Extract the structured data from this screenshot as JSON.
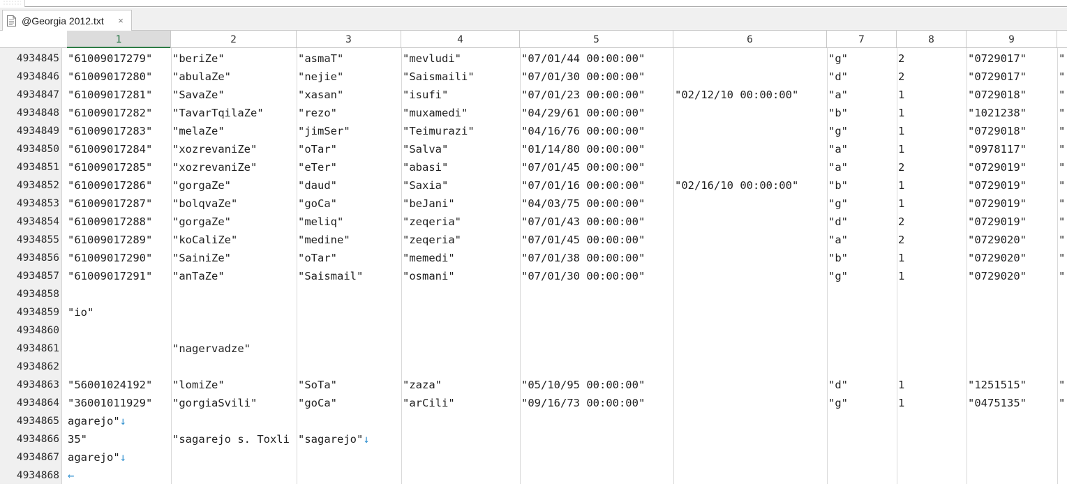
{
  "tab": {
    "title": "@Georgia 2012.txt",
    "close_glyph": "×",
    "icon": "document-icon"
  },
  "columns": [
    "1",
    "2",
    "3",
    "4",
    "5",
    "6",
    "7",
    "8",
    "9"
  ],
  "active_column": 0,
  "colors": {
    "active_column_text": "#1a6f3c",
    "newline_marker": "#2f8fcf"
  },
  "rows": [
    {
      "num": "4934845",
      "cells": [
        "\"61009017279\"",
        "\"beriZe\"",
        "\"asmaT\"",
        "\"mevludi\"",
        "\"07/01/44 00:00:00\"",
        "",
        "\"g\"",
        "2",
        "\"0729017\"",
        "\""
      ]
    },
    {
      "num": "4934846",
      "cells": [
        "\"61009017280\"",
        "\"abulaZe\"",
        "\"nejie\"",
        "\"Saismaili\"",
        "\"07/01/30 00:00:00\"",
        "",
        "\"d\"",
        "2",
        "\"0729017\"",
        "\""
      ]
    },
    {
      "num": "4934847",
      "cells": [
        "\"61009017281\"",
        "\"SavaZe\"",
        "\"xasan\"",
        "\"isufi\"",
        "\"07/01/23 00:00:00\"",
        "\"02/12/10 00:00:00\"",
        "\"a\"",
        "1",
        "\"0729018\"",
        "\""
      ]
    },
    {
      "num": "4934848",
      "cells": [
        "\"61009017282\"",
        "\"TavarTqilaZe\"",
        "\"rezo\"",
        "\"muxamedi\"",
        "\"04/29/61 00:00:00\"",
        "",
        "\"b\"",
        "1",
        "\"1021238\"",
        "\""
      ]
    },
    {
      "num": "4934849",
      "cells": [
        "\"61009017283\"",
        "\"melaZe\"",
        "\"jimSer\"",
        "\"Teimurazi\"",
        "\"04/16/76 00:00:00\"",
        "",
        "\"g\"",
        "1",
        "\"0729018\"",
        "\""
      ]
    },
    {
      "num": "4934850",
      "cells": [
        "\"61009017284\"",
        "\"xozrevaniZe\"",
        "\"oTar\"",
        "\"Salva\"",
        "\"01/14/80 00:00:00\"",
        "",
        "\"a\"",
        "1",
        "\"0978117\"",
        "\""
      ]
    },
    {
      "num": "4934851",
      "cells": [
        "\"61009017285\"",
        "\"xozrevaniZe\"",
        "\"eTer\"",
        "\"abasi\"",
        "\"07/01/45 00:00:00\"",
        "",
        "\"a\"",
        "2",
        "\"0729019\"",
        "\""
      ]
    },
    {
      "num": "4934852",
      "cells": [
        "\"61009017286\"",
        "\"gorgaZe\"",
        "\"daud\"",
        "\"Saxia\"",
        "\"07/01/16 00:00:00\"",
        "\"02/16/10 00:00:00\"",
        "\"b\"",
        "1",
        "\"0729019\"",
        "\""
      ]
    },
    {
      "num": "4934853",
      "cells": [
        "\"61009017287\"",
        "\"bolqvaZe\"",
        "\"goCa\"",
        "\"beJani\"",
        "\"04/03/75 00:00:00\"",
        "",
        "\"g\"",
        "1",
        "\"0729019\"",
        "\""
      ]
    },
    {
      "num": "4934854",
      "cells": [
        "\"61009017288\"",
        "\"gorgaZe\"",
        "\"meliq\"",
        "\"zeqeria\"",
        "\"07/01/43 00:00:00\"",
        "",
        "\"d\"",
        "2",
        "\"0729019\"",
        "\""
      ]
    },
    {
      "num": "4934855",
      "cells": [
        "\"61009017289\"",
        "\"koCaliZe\"",
        "\"medine\"",
        "\"zeqeria\"",
        "\"07/01/45 00:00:00\"",
        "",
        "\"a\"",
        "2",
        "\"0729020\"",
        "\""
      ]
    },
    {
      "num": "4934856",
      "cells": [
        "\"61009017290\"",
        "\"SainiZe\"",
        "\"oTar\"",
        "\"memedi\"",
        "\"07/01/38 00:00:00\"",
        "",
        "\"b\"",
        "1",
        "\"0729020\"",
        "\""
      ]
    },
    {
      "num": "4934857",
      "cells": [
        "\"61009017291\"",
        "\"anTaZe\"",
        "\"Saismail\"",
        "\"osmani\"",
        "\"07/01/30 00:00:00\"",
        "",
        "\"g\"",
        "1",
        "\"0729020\"",
        "\""
      ]
    },
    {
      "num": "4934858",
      "cells": [
        "",
        "",
        "",
        "",
        "",
        "",
        "",
        "",
        "",
        ""
      ]
    },
    {
      "num": "4934859",
      "cells": [
        "\"io\"",
        "",
        "",
        "",
        "",
        "",
        "",
        "",
        "",
        ""
      ]
    },
    {
      "num": "4934860",
      "cells": [
        "",
        "",
        "",
        "",
        "",
        "",
        "",
        "",
        "",
        ""
      ]
    },
    {
      "num": "4934861",
      "cells": [
        "",
        "\"nagervadze\"",
        "",
        "",
        "",
        "",
        "",
        "",
        "",
        ""
      ]
    },
    {
      "num": "4934862",
      "cells": [
        "",
        "",
        "",
        "",
        "",
        "",
        "",
        "",
        "",
        ""
      ]
    },
    {
      "num": "4934863",
      "cells": [
        "\"56001024192\"",
        "\"lomiZe\"",
        "\"SoTa\"",
        "\"zaza\"",
        "\"05/10/95 00:00:00\"",
        "",
        "\"d\"",
        "1",
        "\"1251515\"",
        "\""
      ]
    },
    {
      "num": "4934864",
      "cells": [
        "\"36001011929\"",
        "\"gorgiaSvili\"",
        "\"goCa\"",
        "\"arCili\"",
        "\"09/16/73 00:00:00\"",
        "",
        "\"g\"",
        "1",
        "\"0475135\"",
        "\""
      ]
    },
    {
      "num": "4934865",
      "cells": [
        "agarejo\"",
        "",
        "",
        "",
        "",
        "",
        "",
        "",
        "",
        ""
      ],
      "marks": {
        "0": "↓"
      }
    },
    {
      "num": "4934866",
      "cells": [
        "35\"",
        "\"sagarejo s. Toxli",
        "\"sagarejo\"",
        "",
        "",
        "",
        "",
        "",
        "",
        ""
      ],
      "marks": {
        "2": "↓"
      }
    },
    {
      "num": "4934867",
      "cells": [
        "agarejo\"",
        "",
        "",
        "",
        "",
        "",
        "",
        "",
        "",
        ""
      ],
      "marks": {
        "0": "↓"
      }
    },
    {
      "num": "4934868",
      "cells": [
        "",
        "",
        "",
        "",
        "",
        "",
        "",
        "",
        "",
        ""
      ],
      "marks": {
        "0": "←"
      }
    }
  ]
}
